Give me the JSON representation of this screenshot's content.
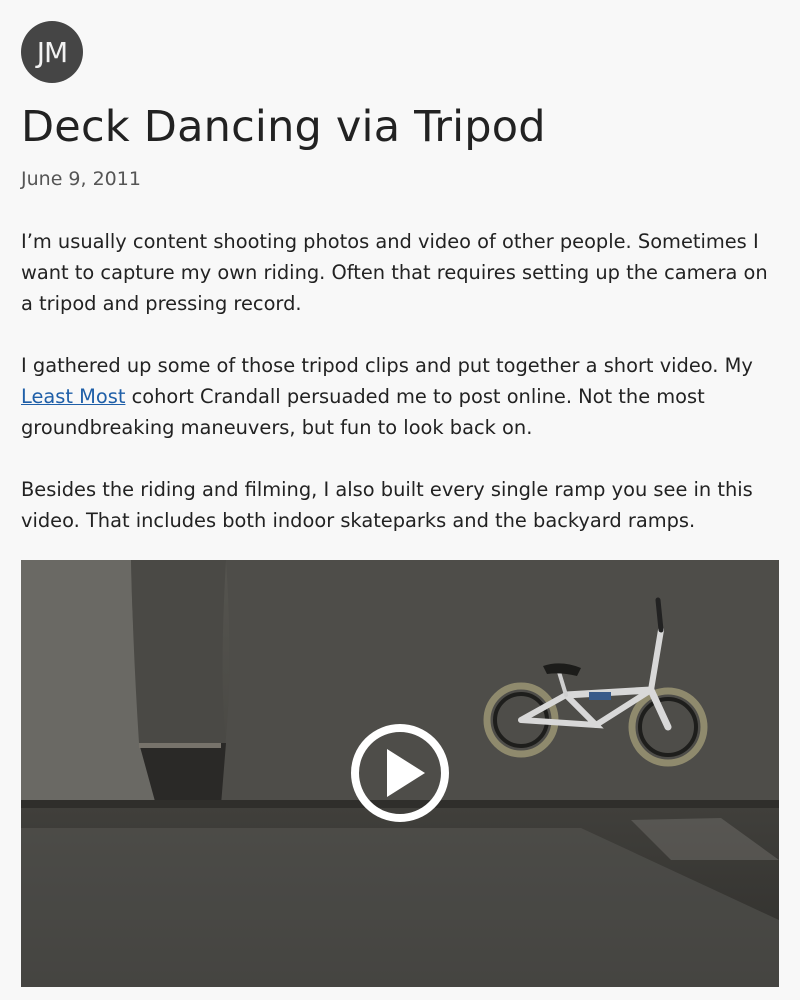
{
  "author": {
    "initials": "JM"
  },
  "post": {
    "title": "Deck Dancing via Tripod",
    "date": "June 9, 2011",
    "p1": "I’m usually content shooting photos and video of other people. Sometimes I want to capture my own riding. Often that requires setting up the camera on a tripod and pressing record.",
    "p2_before": "I gathered up some of those tripod clips and put together a short video. My ",
    "p2_link": "Least Most",
    "p2_after": " cohort Crandall persuaded me to post online. Not the most groundbreaking maneuvers, but fun to look back on.",
    "p3": "Besides the riding and filming, I also built every single ramp you see in this video. That includes both indoor skateparks and the backyard ramps."
  },
  "video": {
    "play_icon": "play-circle-icon"
  }
}
